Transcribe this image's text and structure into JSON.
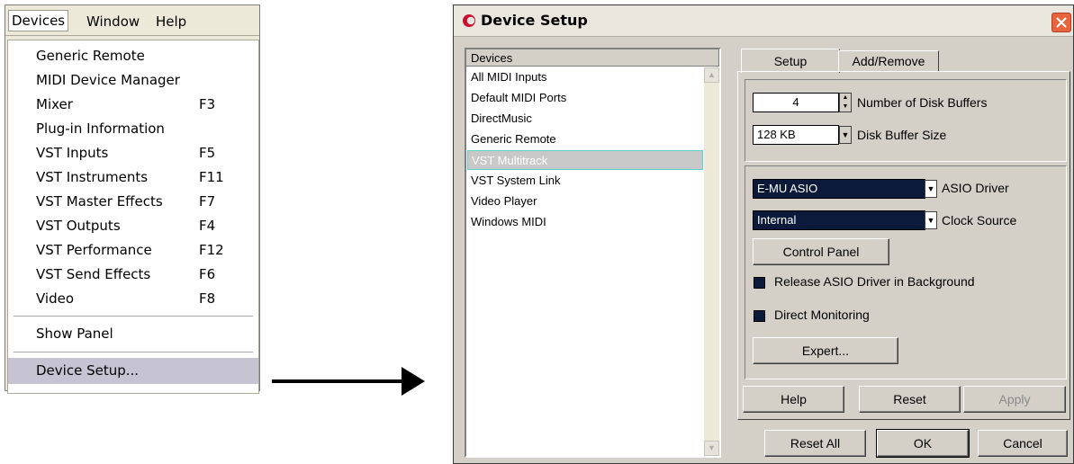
{
  "menu": {
    "bar": [
      "Devices",
      "Window",
      "Help"
    ],
    "items": [
      {
        "label": "Generic Remote",
        "shortcut": ""
      },
      {
        "label": "MIDI Device Manager",
        "shortcut": ""
      },
      {
        "label": "Mixer",
        "shortcut": "F3"
      },
      {
        "label": "Plug-in Information",
        "shortcut": ""
      },
      {
        "label": "VST Inputs",
        "shortcut": "F5"
      },
      {
        "label": "VST Instruments",
        "shortcut": "F11"
      },
      {
        "label": "VST Master Effects",
        "shortcut": "F7"
      },
      {
        "label": "VST Outputs",
        "shortcut": "F4"
      },
      {
        "label": "VST Performance",
        "shortcut": "F12"
      },
      {
        "label": "VST Send Effects",
        "shortcut": "F6"
      },
      {
        "label": "Video",
        "shortcut": "F8"
      },
      {
        "label": "Show Panel",
        "shortcut": ""
      },
      {
        "label": "Device Setup...",
        "shortcut": ""
      }
    ]
  },
  "dialog": {
    "title": "Device Setup",
    "devices_header": "Devices",
    "devices": [
      "All MIDI Inputs",
      "Default MIDI Ports",
      "DirectMusic",
      "Generic Remote",
      "VST Multitrack",
      "VST System Link",
      "Video Player",
      "Windows MIDI"
    ],
    "tabs": [
      "Setup",
      "Add/Remove"
    ],
    "disk_buffers_value": "4",
    "disk_buffers_label": "Number of Disk Buffers",
    "buffer_size_value": "128 KB",
    "buffer_size_label": "Disk Buffer Size",
    "asio_driver_value": "E-MU ASIO",
    "asio_driver_label": "ASIO Driver",
    "clock_source_value": "Internal",
    "clock_source_label": "Clock Source",
    "control_panel": "Control Panel",
    "release_asio": "Release ASIO Driver in Background",
    "direct_monitoring": "Direct Monitoring",
    "expert": "Expert...",
    "help": "Help",
    "reset": "Reset",
    "apply": "Apply",
    "reset_all": "Reset All",
    "ok": "OK",
    "cancel": "Cancel"
  }
}
